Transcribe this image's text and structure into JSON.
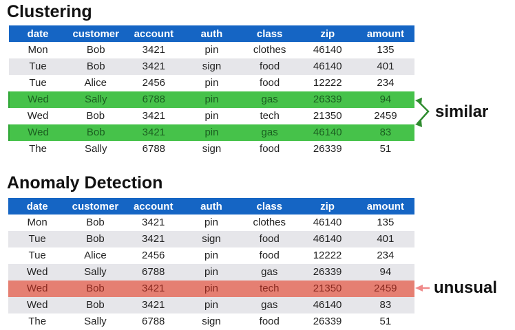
{
  "columns": [
    "date",
    "customer",
    "account",
    "auth",
    "class",
    "zip",
    "amount"
  ],
  "clustering": {
    "title": "Clustering",
    "rows": [
      [
        "Mon",
        "Bob",
        "3421",
        "pin",
        "clothes",
        "46140",
        "135"
      ],
      [
        "Tue",
        "Bob",
        "3421",
        "sign",
        "food",
        "46140",
        "401"
      ],
      [
        "Tue",
        "Alice",
        "2456",
        "pin",
        "food",
        "12222",
        "234"
      ],
      [
        "Wed",
        "Sally",
        "6788",
        "pin",
        "gas",
        "26339",
        "94"
      ],
      [
        "Wed",
        "Bob",
        "3421",
        "pin",
        "tech",
        "21350",
        "2459"
      ],
      [
        "Wed",
        "Bob",
        "3421",
        "pin",
        "gas",
        "46140",
        "83"
      ],
      [
        "The",
        "Sally",
        "6788",
        "sign",
        "food",
        "26339",
        "51"
      ]
    ],
    "highlighted_rows": [
      3,
      5
    ],
    "highlight_color": "#46c24a",
    "callout": "similar",
    "callout_color": "#2e8b2e"
  },
  "anomaly": {
    "title": "Anomaly Detection",
    "rows": [
      [
        "Mon",
        "Bob",
        "3421",
        "pin",
        "clothes",
        "46140",
        "135"
      ],
      [
        "Tue",
        "Bob",
        "3421",
        "sign",
        "food",
        "46140",
        "401"
      ],
      [
        "Tue",
        "Alice",
        "2456",
        "pin",
        "food",
        "12222",
        "234"
      ],
      [
        "Wed",
        "Sally",
        "6788",
        "pin",
        "gas",
        "26339",
        "94"
      ],
      [
        "Wed",
        "Bob",
        "3421",
        "pin",
        "tech",
        "21350",
        "2459"
      ],
      [
        "Wed",
        "Bob",
        "3421",
        "pin",
        "gas",
        "46140",
        "83"
      ],
      [
        "The",
        "Sally",
        "6788",
        "sign",
        "food",
        "26339",
        "51"
      ]
    ],
    "highlighted_rows": [
      4
    ],
    "highlight_color": "#e57f72",
    "callout": "unusual",
    "callout_color": "#f08a8a"
  },
  "header_color": "#1565c4",
  "stripe_color": "#e6e6ea"
}
